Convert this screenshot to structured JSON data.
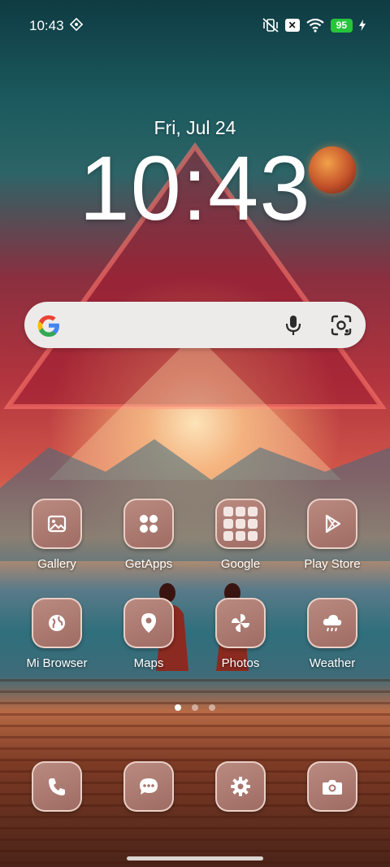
{
  "status_bar": {
    "time": "10:43",
    "battery_level": "95",
    "icons": [
      "vpn-diamond-icon",
      "mute-vibrate-icon",
      "x-badge-icon",
      "wifi-icon",
      "battery-icon",
      "charging-bolt-icon"
    ],
    "x_badge": "✕"
  },
  "lockscreen": {
    "date": "Fri, Jul 24",
    "time": "10:43"
  },
  "search": {
    "icons": [
      "google-logo",
      "mic-icon",
      "google-lens-icon"
    ]
  },
  "apps": [
    {
      "label": "Gallery",
      "icon": "gallery-icon"
    },
    {
      "label": "GetApps",
      "icon": "getapps-icon"
    },
    {
      "label": "Google",
      "icon": "google-folder-icon"
    },
    {
      "label": "Play Store",
      "icon": "play-store-icon"
    },
    {
      "label": "Mi Browser",
      "icon": "globe-icon"
    },
    {
      "label": "Maps",
      "icon": "map-pin-icon"
    },
    {
      "label": "Photos",
      "icon": "pinwheel-icon"
    },
    {
      "label": "Weather",
      "icon": "cloud-rain-icon"
    }
  ],
  "dock": [
    {
      "icon": "phone-icon"
    },
    {
      "icon": "messages-icon"
    },
    {
      "icon": "settings-gear-icon"
    },
    {
      "icon": "camera-icon"
    }
  ],
  "page_indicator": {
    "pages": 3,
    "current": 1
  },
  "colors": {
    "icon_tile": "#a9756d",
    "search_bg": "#ecebea",
    "battery": "#27c43b"
  }
}
